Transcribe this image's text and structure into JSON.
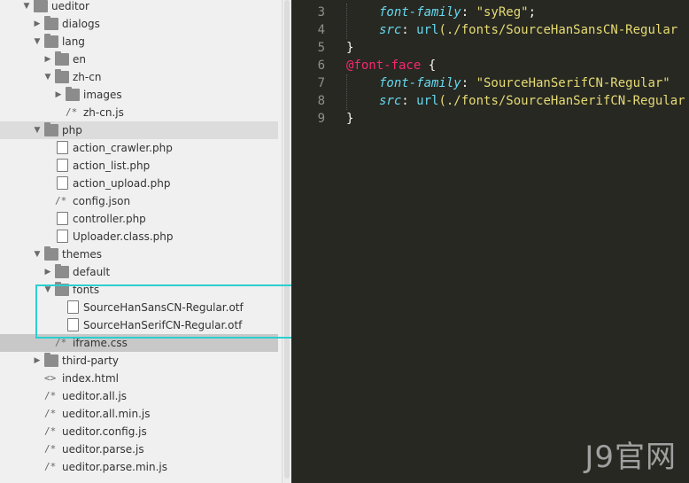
{
  "sidebar": {
    "rows": [
      {
        "label": "ueditor",
        "type": "folder",
        "open": true,
        "indent": 0
      },
      {
        "label": "dialogs",
        "type": "folder",
        "open": false,
        "indent": 1
      },
      {
        "label": "lang",
        "type": "folder",
        "open": true,
        "indent": 1
      },
      {
        "label": "en",
        "type": "folder",
        "open": false,
        "indent": 2
      },
      {
        "label": "zh-cn",
        "type": "folder",
        "open": true,
        "indent": 2
      },
      {
        "label": "images",
        "type": "folder",
        "open": false,
        "indent": 3
      },
      {
        "label": "zh-cn.js",
        "type": "comment",
        "indent": 3
      },
      {
        "label": "php",
        "type": "folder",
        "open": true,
        "indent": 1,
        "selected": true
      },
      {
        "label": "action_crawler.php",
        "type": "file",
        "indent": 2
      },
      {
        "label": "action_list.php",
        "type": "file",
        "indent": 2
      },
      {
        "label": "action_upload.php",
        "type": "file",
        "indent": 2
      },
      {
        "label": "config.json",
        "type": "comment",
        "indent": 2
      },
      {
        "label": "controller.php",
        "type": "file",
        "indent": 2
      },
      {
        "label": "Uploader.class.php",
        "type": "file",
        "indent": 2
      },
      {
        "label": "themes",
        "type": "folder",
        "open": true,
        "indent": 1
      },
      {
        "label": "default",
        "type": "folder",
        "open": false,
        "indent": 2
      },
      {
        "label": "fonts",
        "type": "folder",
        "open": true,
        "indent": 2
      },
      {
        "label": "SourceHanSansCN-Regular.otf",
        "type": "file",
        "indent": 3
      },
      {
        "label": "SourceHanSerifCN-Regular.otf",
        "type": "file",
        "indent": 3
      },
      {
        "label": "iframe.css",
        "type": "comment",
        "indent": 2,
        "selected_dark": true
      },
      {
        "label": "third-party",
        "type": "folder",
        "open": false,
        "indent": 1
      },
      {
        "label": "index.html",
        "type": "html",
        "indent": 1
      },
      {
        "label": "ueditor.all.js",
        "type": "comment",
        "indent": 1
      },
      {
        "label": "ueditor.all.min.js",
        "type": "comment",
        "indent": 1
      },
      {
        "label": "ueditor.config.js",
        "type": "comment",
        "indent": 1
      },
      {
        "label": "ueditor.parse.js",
        "type": "comment",
        "indent": 1
      },
      {
        "label": "ueditor.parse.min.js",
        "type": "comment",
        "indent": 1
      }
    ]
  },
  "editor": {
    "lines": [
      {
        "num": "3",
        "indent": 1,
        "tokens": [
          {
            "t": "font-family",
            "c": "prop"
          },
          {
            "t": ": ",
            "c": "plain"
          },
          {
            "t": "\"syReg\"",
            "c": "str"
          },
          {
            "t": ";",
            "c": "plain"
          }
        ]
      },
      {
        "num": "4",
        "indent": 1,
        "tokens": [
          {
            "t": "src",
            "c": "prop"
          },
          {
            "t": ": ",
            "c": "plain"
          },
          {
            "t": "url",
            "c": "fn"
          },
          {
            "t": "(./fonts/SourceHanSansCN-Regular",
            "c": "str"
          }
        ]
      },
      {
        "num": "5",
        "indent": 0,
        "tokens": [
          {
            "t": "}",
            "c": "plain"
          }
        ]
      },
      {
        "num": "6",
        "indent": 0,
        "tokens": [
          {
            "t": "@font-face",
            "c": "at"
          },
          {
            "t": " {",
            "c": "plain"
          }
        ]
      },
      {
        "num": "7",
        "indent": 1,
        "tokens": [
          {
            "t": "font-family",
            "c": "prop"
          },
          {
            "t": ": ",
            "c": "plain"
          },
          {
            "t": "\"SourceHanSerifCN-Regular\"",
            "c": "str"
          }
        ]
      },
      {
        "num": "8",
        "indent": 1,
        "tokens": [
          {
            "t": "src",
            "c": "prop"
          },
          {
            "t": ": ",
            "c": "plain"
          },
          {
            "t": "url",
            "c": "fn"
          },
          {
            "t": "(./fonts/SourceHanSerifCN-Regular",
            "c": "str"
          }
        ]
      },
      {
        "num": "9",
        "indent": 0,
        "tokens": [
          {
            "t": "}",
            "c": "plain"
          }
        ]
      }
    ]
  },
  "colors": {
    "prop": "#66d9ef",
    "str": "#e6db74",
    "fn": "#66d9ef",
    "at": "#f92672",
    "plain": "#f8f8f2",
    "highlight": "#2bcfd0"
  },
  "watermark": "J9官网"
}
